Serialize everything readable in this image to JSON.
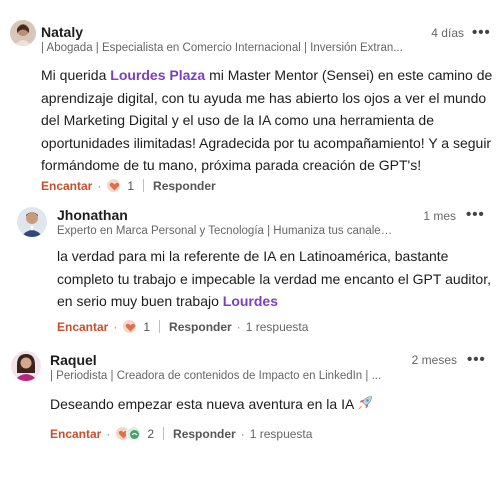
{
  "comments": [
    {
      "name": "Nataly",
      "headline": "| Abogada | Especialista en Comercio Internacional | Inversión Extran...",
      "time": "4 días",
      "body_parts": [
        "Mi querida ",
        "Lourdes Plaza",
        " mi Master Mentor (Sensei) en este camino de aprendizaje digital, con tu ayuda me has abierto los ojos a ver el mundo del Marketing Digital y el uso de la IA como una herramienta de oportunidades ilimitadas! Agradecida por tu acompañamiento! Y a seguir formándome de tu mano, próxima parada creación de GPT's!"
      ],
      "react_label": "Encantar",
      "reaction_count": "1",
      "reply_label": "Responder"
    },
    {
      "name": "Jhonathan",
      "headline": "Experto en Marca Personal y Tecnología | Humaniza tus canales ...",
      "time": "1 mes",
      "body_parts": [
        "la verdad para mi la referente de IA en Latinoamérica, bastante completo tu trabajo e impecable la verdad me encanto el GPT auditor, en serio muy buen trabajo ",
        "Lourdes"
      ],
      "react_label": "Encantar",
      "reaction_count": "1",
      "reply_label": "Responder",
      "replies_label": "1 respuesta"
    },
    {
      "name": "Raquel",
      "headline": "| Periodista | Creadora de contenidos de Impacto en LinkedIn | ...",
      "time": "2 meses",
      "body_text": "Deseando empezar esta nueva aventura en la IA",
      "react_label": "Encantar",
      "reaction_count": "2",
      "reply_label": "Responder",
      "replies_label": "1 respuesta"
    }
  ],
  "more_glyph": "•••",
  "dot_glyph": "·",
  "icons": {
    "love_reaction": "heart-icon",
    "support_reaction": "support-icon",
    "rocket_emoji": "rocket-icon"
  },
  "colors": {
    "mention": "#7b3fbf",
    "react_active": "#c94f2c"
  }
}
